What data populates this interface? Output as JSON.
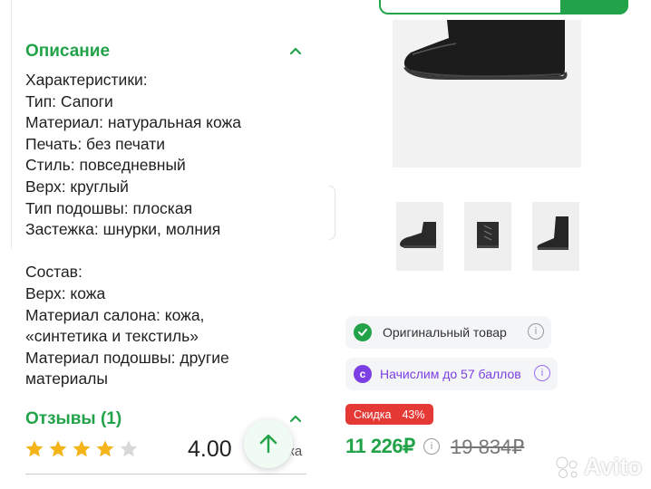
{
  "description": {
    "title": "Описание",
    "lines": [
      "Характеристики:",
      "Тип: Сапоги",
      "Материал: натуральная кожа",
      "Печать: без печати",
      "Стиль: повседневный",
      "Верх: круглый",
      "Тип подошвы: плоская",
      "Застежка: шнурки, молния",
      "",
      "Состав:",
      "Верх: кожа",
      "Материал салона: кожа,",
      "«синтетика и текстиль»",
      "Материал подошвы: другие",
      "материалы"
    ]
  },
  "reviews": {
    "title": "Отзывы (1)",
    "rating_value": "4.00",
    "rating_suffix": "ка",
    "stars_filled": 4,
    "stars_total": 5
  },
  "product": {
    "badges": {
      "original": "Оригинальный товар",
      "bonus": "Начислим до 57 баллов"
    },
    "discount_label": "Скидка",
    "discount_value": "43%",
    "price": "11 226₽",
    "old_price": "19 834₽"
  },
  "watermark": "Avito",
  "colors": {
    "accent": "#22a34a",
    "discount": "#e53935",
    "bonus": "#7b3fe4",
    "star": "#f4b41a",
    "star_empty": "#d8d8d8"
  }
}
